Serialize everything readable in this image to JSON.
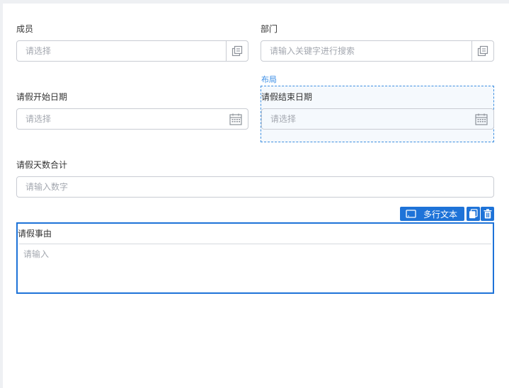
{
  "form": {
    "member": {
      "label": "成员",
      "placeholder": "请选择"
    },
    "department": {
      "label": "部门",
      "placeholder": "请输入关键字进行搜索"
    },
    "leave_start": {
      "label": "请假开始日期",
      "placeholder": "请选择"
    },
    "layout_tag": "布局",
    "leave_end": {
      "label": "请假结束日期",
      "placeholder": "请选择"
    },
    "total_days": {
      "label": "请假天数合计",
      "placeholder": "请输入数字"
    },
    "reason": {
      "label": "请假事由",
      "placeholder": "请输入"
    }
  },
  "toolbar": {
    "component_type": "多行文本",
    "copy_icon": "copy-icon",
    "delete_icon": "trash-icon"
  },
  "icons": {
    "picker": "select-dialog-icon",
    "calendar": "calendar-icon",
    "textarea": "textarea-icon"
  },
  "colors": {
    "accent": "#1e73d8",
    "layout_border": "#3c8ee0",
    "placeholder": "#a4a8b0"
  }
}
